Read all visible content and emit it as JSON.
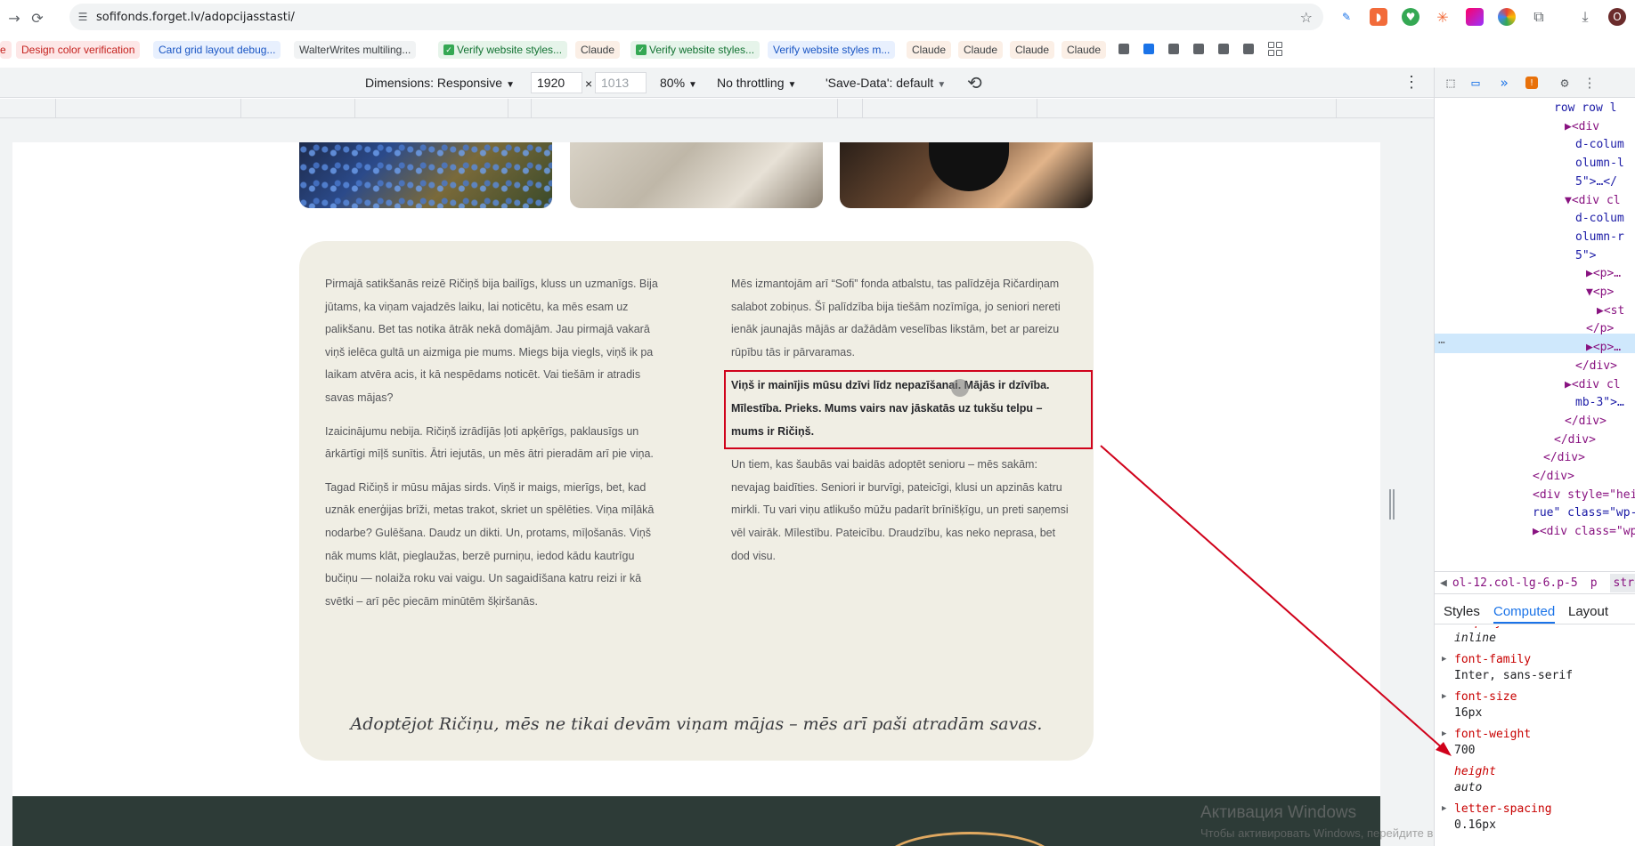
{
  "browser": {
    "url": "sofifonds.forget.lv/adopcijasstasti/",
    "avatar_letter": "O"
  },
  "bookmarks": [
    {
      "label": "Design color verification",
      "style": "red"
    },
    {
      "label": "Card grid layout debug...",
      "style": "blue"
    },
    {
      "label": "WalterWrites multiling...",
      "style": "gray"
    },
    {
      "label": "Verify website styles...",
      "style": "green"
    },
    {
      "label": "Claude",
      "style": "claude"
    },
    {
      "label": "Verify website styles...",
      "style": "green"
    },
    {
      "label": "Verify website styles m...",
      "style": "blue"
    },
    {
      "label": "Claude",
      "style": "claude"
    },
    {
      "label": "Claude",
      "style": "claude"
    },
    {
      "label": "Claude",
      "style": "claude"
    },
    {
      "label": "Claude",
      "style": "claude"
    }
  ],
  "device_toolbar": {
    "dimensions": "Dimensions: Responsive",
    "width": "1920",
    "times": "×",
    "height_placeholder": "1013",
    "zoom": "80%",
    "throttling": "No throttling",
    "save_data": "'Save-Data': default"
  },
  "page": {
    "left_paragraphs": [
      "Pirmajā satikšanās reizē Ričiņš bija bailīgs, kluss un uzmanīgs. Bija jūtams, ka viņam vajadzēs laiku, lai noticētu, ka mēs esam uz palikšanu. Bet tas notika ātrāk nekā domājām. Jau pirmajā vakarā viņš ielēca gultā un aizmiga pie mums. Miegs bija viegls, viņš ik pa laikam atvēra acis, it kā nespēdams noticēt. Vai tiešām ir atradis savas mājas?",
      "Izaicinājumu nebija. Ričiņš izrādījās ļoti apķērīgs, paklausīgs un ārkārtīgi mīļš sunītis. Ātri iejutās, un mēs ātri pieradām arī pie viņa.",
      "Tagad Ričiņš ir mūsu mājas sirds. Viņš ir maigs, mierīgs, bet, kad uznāk enerģijas brīži, metas trakot, skriet un spēlēties. Viņa mīļākā nodarbe? Gulēšana. Daudz un dikti. Un, protams, mīļošanās. Viņš nāk mums klāt, pieglaužas, berzē purniņu, iedod kādu kautrīgu bučiņu — nolaiža roku vai vaigu. Un sagaidīšana katru reizi ir kā svētki – arī pēc piecām minūtēm šķiršanās."
    ],
    "right_paragraph_1": "Mēs izmantojām arī “Sofi” fonda atbalstu, tas palīdzēja Ričardiņam salabot zobiņus. Šī palīdzība bija tiešām nozīmīga, jo seniori nereti ienāk jaunajās mājās ar dažādām veselības likstām, bet ar pareizu rūpību tās ir pārvaramas.",
    "right_bold": "Viņš ir mainījis mūsu dzīvi līdz nepazīšanai. Mājās ir dzīvība. Mīlestība. Prieks. Mums vairs nav jāskatās uz tukšu telpu – mums ir Ričiņš.",
    "right_paragraph_2": "Un tiem, kas šaubās vai baidās adoptēt senioru – mēs sakām: nevajag baidīties. Seniori ir burvīgi, pateicīgi, klusi un apzinās katru mirkli. Tu vari viņu atlikušo mūžu padarīt brīnišķīgu, un preti saņemsi vēl vairāk. Mīlestību. Pateicību. Draudzību, kas neko neprasa, bet dod visu.",
    "quote": "Adoptējot Ričiņu, mēs ne tikai devām viņam mājas – mēs arī paši atradām savas."
  },
  "watermark": {
    "line1": "Активация Windows",
    "line2": "Чтобы активировать Windows, перейдите в раздел \"Параметры\"."
  },
  "devtools": {
    "elements": [
      {
        "text": "row row l",
        "indent": 0
      },
      {
        "text": "▶<div",
        "indent": 1
      },
      {
        "text": "d-colum",
        "indent": 2
      },
      {
        "text": "olumn-l",
        "indent": 2
      },
      {
        "text": "5\">…</",
        "indent": 2
      },
      {
        "text": "▼<div cl",
        "indent": 1
      },
      {
        "text": "d-colum",
        "indent": 2
      },
      {
        "text": "olumn-r",
        "indent": 2
      },
      {
        "text": "5\">",
        "indent": 2
      },
      {
        "text": "▶<p>…",
        "indent": 3
      },
      {
        "text": "▼<p>",
        "indent": 3
      },
      {
        "text": "▶<st",
        "indent": 4
      },
      {
        "text": "</p>",
        "indent": 3
      },
      {
        "text": "▶<p>…",
        "indent": 3
      },
      {
        "text": "</div>",
        "indent": 2
      },
      {
        "text": "▶<div cl",
        "indent": 1
      },
      {
        "text": "mb-3\">…",
        "indent": 2
      },
      {
        "text": "</div>",
        "indent": 1
      },
      {
        "text": "</div>",
        "indent": 0
      },
      {
        "text": "</div>",
        "indent": -1
      },
      {
        "text": "</div>",
        "indent": -2
      },
      {
        "text": "<div style=\"hei",
        "indent": -2
      },
      {
        "text": "rue\" class=\"wp-",
        "indent": -2
      },
      {
        "text": "▶<div class=\"wp",
        "indent": -2
      }
    ],
    "breadcrumb": [
      "ol-12.col-lg-6.p-5",
      "p",
      "strong"
    ],
    "subtabs": [
      "Styles",
      "Computed",
      "Layout"
    ],
    "computed": [
      {
        "name": "display",
        "value": "inline",
        "muted": true
      },
      {
        "name": "font-family",
        "value": "Inter, sans-serif",
        "muted": false
      },
      {
        "name": "font-size",
        "value": "16px",
        "muted": false
      },
      {
        "name": "font-weight",
        "value": "700",
        "muted": false
      },
      {
        "name": "height",
        "value": "auto",
        "muted": true
      },
      {
        "name": "letter-spacing",
        "value": "0.16px",
        "muted": false
      }
    ]
  }
}
